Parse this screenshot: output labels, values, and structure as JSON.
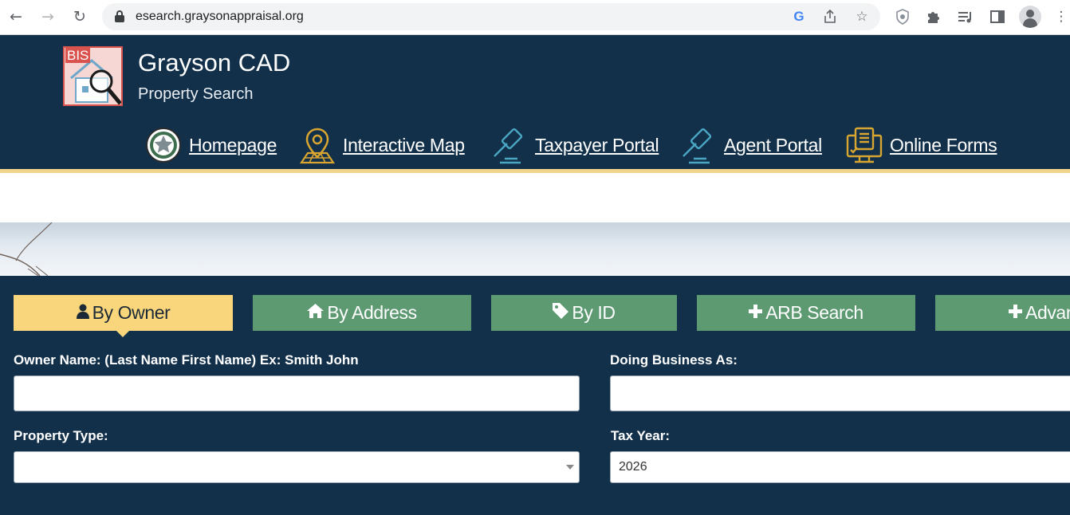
{
  "browser": {
    "url": "esearch.graysonappraisal.org",
    "toolbar_icons": [
      "back-arrow-icon",
      "forward-arrow-icon",
      "reload-icon",
      "lock-icon",
      "google-icon",
      "share-icon",
      "bookmark-star-icon",
      "shield-extension-icon",
      "extensions-puzzle-icon",
      "media-queue-icon",
      "side-panel-icon",
      "profile-avatar-icon",
      "more-menu-icon"
    ]
  },
  "header": {
    "logo_text": "BIS",
    "title": "Grayson CAD",
    "subtitle": "Property Search",
    "background": "#12304a",
    "links": [
      {
        "label": "Homepage",
        "icon": "texas-seal-icon"
      },
      {
        "label": "Interactive Map",
        "icon": "map-pin-icon"
      },
      {
        "label": "Taxpayer Portal",
        "icon": "gavel-icon"
      },
      {
        "label": "Agent Portal",
        "icon": "gavel-icon"
      },
      {
        "label": "Online Forms",
        "icon": "computer-form-icon"
      }
    ]
  },
  "search": {
    "tabs": [
      {
        "label": "By Owner",
        "icon": "user-icon",
        "active": true
      },
      {
        "label": "By Address",
        "icon": "home-icon",
        "active": false
      },
      {
        "label": "By ID",
        "icon": "tag-icon",
        "active": false
      },
      {
        "label": "ARB Search",
        "icon": "plus-icon",
        "active": false
      },
      {
        "label": "Advan",
        "icon": "plus-icon",
        "active": false
      }
    ],
    "active_tab_color": "#f9d57c",
    "tab_color": "#5d9a72",
    "fields": {
      "owner_name_label": "Owner Name: (Last Name First Name) Ex: Smith John",
      "owner_name_value": "",
      "dba_label": "Doing Business As:",
      "dba_value": "",
      "property_type_label": "Property Type:",
      "property_type_value": "",
      "tax_year_label": "Tax Year:",
      "tax_year_value": "2026"
    }
  }
}
